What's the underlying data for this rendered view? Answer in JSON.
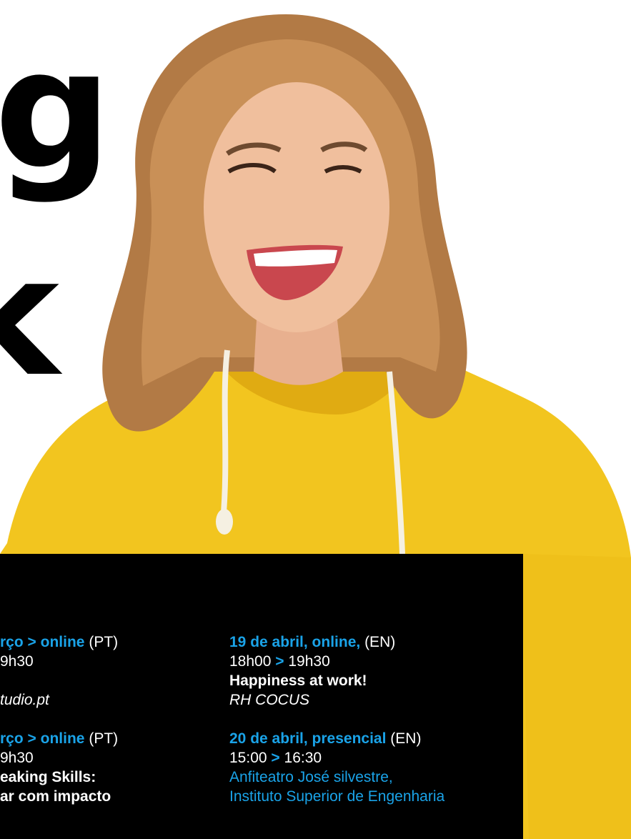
{
  "headline": {
    "top": "g",
    "bottom": "k"
  },
  "colors": {
    "panel": "#000000",
    "accent": "#1aa3e8",
    "hoodie": "#f2c51f",
    "text": "#ffffff"
  },
  "left_column": {
    "event1": {
      "date": "rço",
      "sep": ">",
      "mode": "online",
      "lang": "(PT)",
      "time": "9h30",
      "host": "tudio.pt"
    },
    "event2": {
      "date": "rço",
      "sep": ">",
      "mode": "online",
      "lang": "(PT)",
      "time": "9h30",
      "title1": "eaking Skills:",
      "title2": "ar com impacto"
    }
  },
  "right_column": {
    "event1": {
      "date": "19 de abril, online,",
      "lang": "(EN)",
      "start": "18h00",
      "sep": ">",
      "end": "19h30",
      "title": "Happiness at work!",
      "host": "RH COCUS"
    },
    "event2": {
      "date": "20 de abril, presencial",
      "lang": "(EN)",
      "start": "15:00",
      "sep": ">",
      "end": "16:30",
      "venue1": "Anfiteatro José silvestre,",
      "venue2": "Instituto Superior de Engenharia"
    }
  }
}
